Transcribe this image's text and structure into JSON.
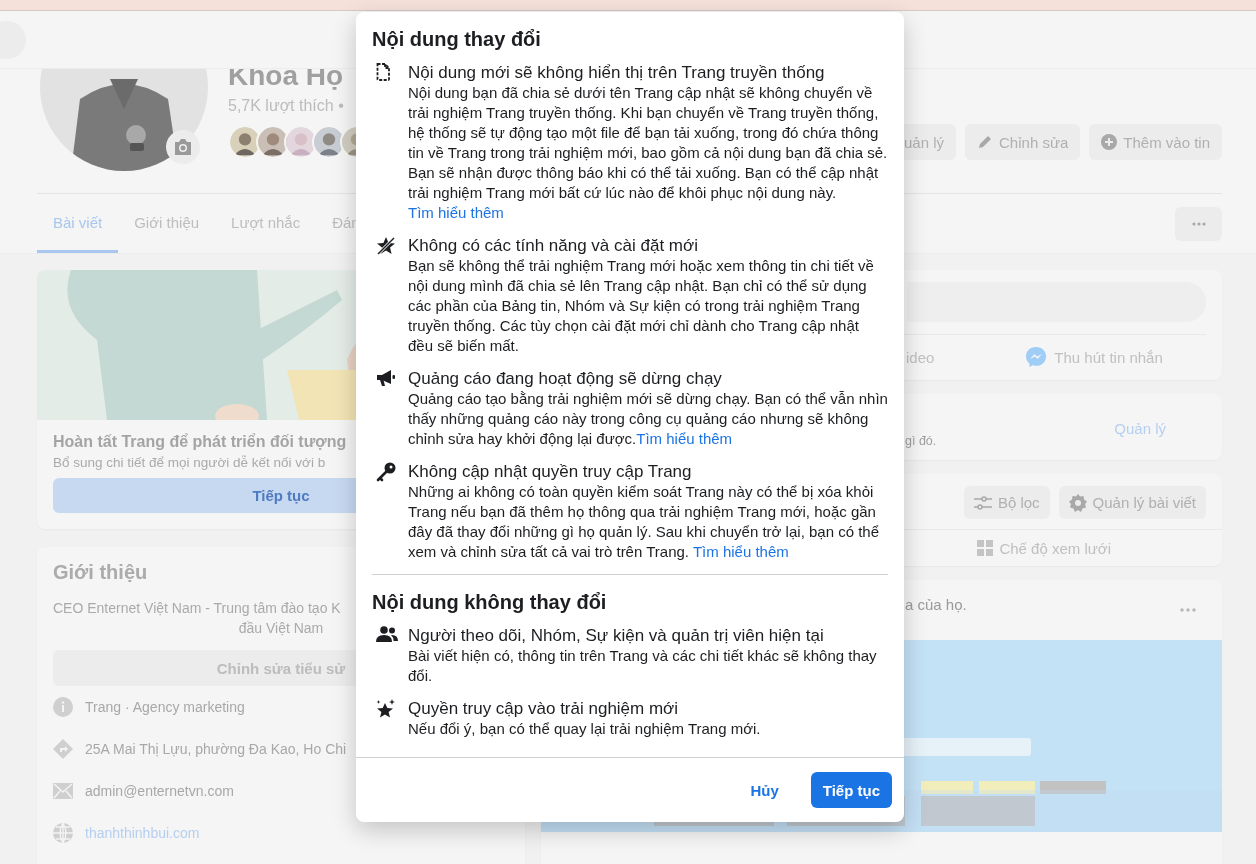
{
  "profile": {
    "name": "Khoa Họ",
    "likes": "5,7K lượt thích •",
    "actions": [
      "uản lý",
      "Chỉnh sửa",
      "Thêm vào tin"
    ]
  },
  "tabs": [
    {
      "label": "Bài viết",
      "selected": true
    },
    {
      "label": "Giới thiệu",
      "selected": false
    },
    {
      "label": "Lượt nhắc",
      "selected": false
    },
    {
      "label": "Đán",
      "selected": false
    }
  ],
  "setup_card": {
    "title": "Hoàn tất Trang để phát triển đối tượng",
    "text": "Bổ sung chi tiết để mọi người dễ kết nối với b",
    "button": "Tiếp tục"
  },
  "intro": {
    "title": "Giới thiệu",
    "bio": [
      "CEO Enternet Việt Nam - Trung tâm đào tạo K",
      "đầu Việt Nam"
    ],
    "edit_button": "Chỉnh sửa tiểu sử",
    "details": [
      {
        "kind": "category",
        "text": "**Trang** · Agency marketing"
      },
      {
        "kind": "address",
        "text": "25A Mai Thị Lựu, phường Đa Kao, Ho Chi"
      },
      {
        "kind": "email",
        "text": "admin@enternetvn.com"
      },
      {
        "kind": "website",
        "text": "thanhthinhbui.com"
      }
    ]
  },
  "composer": {
    "actions": [
      "ideo",
      "Thu hút tin nhắn"
    ]
  },
  "manage_card": {
    "text": "gì đó.",
    "link": "Quản lý"
  },
  "posts_toolbar": {
    "buttons": [
      "Bộ lọc",
      "Quản lý bài viết"
    ],
    "view": "Chế độ xem lưới"
  },
  "post": {
    "text": "a của họ."
  },
  "dialog": {
    "sections": [
      {
        "title": "Nội dung thay đổi",
        "items": [
          {
            "kind": "document",
            "title": "Nội dung mới sẽ không hiển thị trên Trang truyền thống",
            "text": "Nội dung bạn đã chia sẻ dưới tên Trang cập nhật sẽ không chuyển về trải nghiệm Trang truyền thống. Khi bạn chuyển về Trang truyền thống, hệ thống sẽ tự động tạo một file để bạn tải xuống, trong đó chứa thông tin về Trang trong trải nghiệm mới, bao gồm cả nội dung bạn đã chia sẻ. Bạn sẽ nhận được thông báo khi có thể tải xuống. Bạn có thể cập nhật trải nghiệm Trang mới bất cứ lúc nào để khôi phục nội dung này. ",
            "link": "Tìm hiểu thêm"
          },
          {
            "kind": "nostar",
            "title": "Không có các tính năng và cài đặt mới",
            "text": "Bạn sẽ không thể trải nghiệm Trang mới hoặc xem thông tin chi tiết về nội dung mình đã chia sẻ lên Trang cập nhật. Bạn chỉ có thể sử dụng các phần của Bảng tin, Nhóm và Sự kiện có trong trải nghiệm Trang truyền thống. Các tùy chọn cài đặt mới chỉ dành cho Trang cập nhật đều sẽ biến mất."
          },
          {
            "kind": "megaphone",
            "title": "Quảng cáo đang hoạt động sẽ dừng chạy",
            "text": "Quảng cáo tạo bằng trải nghiệm mới sẽ dừng chạy. Bạn có thể vẫn nhìn thấy những quảng cáo này trong công cụ quảng cáo nhưng sẽ không chỉnh sửa hay khởi động lại được.",
            "link": "Tìm hiểu thêm"
          },
          {
            "kind": "key",
            "title": "Không cập nhật quyền truy cập Trang",
            "text": "Những ai không có toàn quyền kiểm soát Trang này có thể bị xóa khỏi Trang nếu bạn đã thêm họ thông qua trải nghiệm Trang mới, hoặc gần đây đã thay đổi những gì họ quản lý. Sau khi chuyển trở lại, bạn có thể xem và chỉnh sửa tất cả vai trò trên Trang. ",
            "link": "Tìm hiểu thêm"
          }
        ]
      },
      {
        "title": "Nội dung không thay đổi",
        "items": [
          {
            "kind": "people",
            "title": "Người theo dõi, Nhóm, Sự kiện và quản trị viên hiện tại",
            "text": "Bài viết hiện có, thông tin trên Trang và các chi tiết khác sẽ không thay đổi."
          },
          {
            "kind": "sparkle",
            "title": "Quyền truy cập vào trải nghiệm mới",
            "text": "Nếu đổi ý, bạn có thể quay lại trải nghiệm Trang mới."
          }
        ]
      }
    ],
    "cancel": "Hủy",
    "confirm": "Tiếp tục"
  }
}
